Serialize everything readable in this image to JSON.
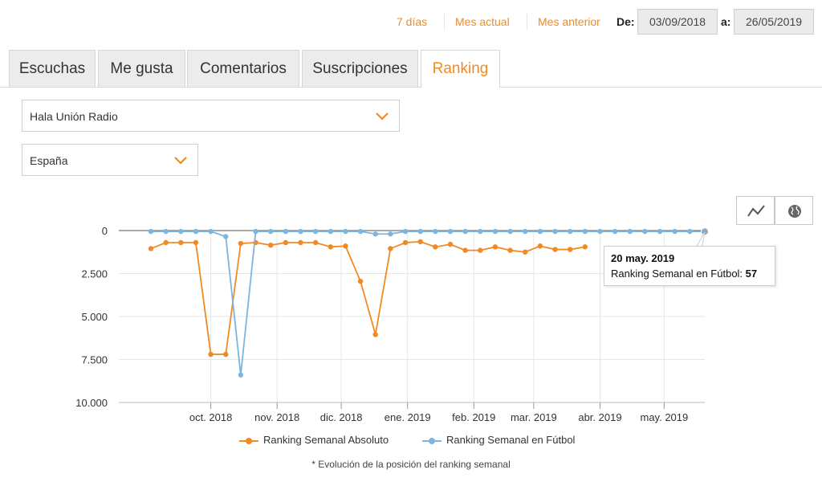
{
  "header": {
    "periods": [
      {
        "label": "7 días"
      },
      {
        "label": "Mes actual"
      },
      {
        "label": "Mes anterior"
      }
    ],
    "from_label": "De:",
    "from_date": "03/09/2018",
    "to_label": "a:",
    "to_date": "26/05/2019"
  },
  "tabs": [
    {
      "label": "Escuchas",
      "active": false
    },
    {
      "label": "Me gusta",
      "active": false
    },
    {
      "label": "Comentarios",
      "active": false
    },
    {
      "label": "Suscripciones",
      "active": false
    },
    {
      "label": "Ranking",
      "active": true
    }
  ],
  "filters": {
    "program": "Hala Unión Radio",
    "country": "España"
  },
  "chart_tools": {
    "line_icon": "line-chart-icon",
    "map_icon": "globe-icon"
  },
  "colors": {
    "accent": "#f08a24",
    "series_absoluto": "#f08a24",
    "series_futbol": "#7cb5de"
  },
  "chart_data": {
    "type": "line",
    "y_reversed": true,
    "ylim": [
      0,
      10000
    ],
    "y_ticks": [
      {
        "value": 0,
        "label": "0"
      },
      {
        "value": 2500,
        "label": "2.500"
      },
      {
        "value": 5000,
        "label": "5.000"
      },
      {
        "value": 7500,
        "label": "7.500"
      },
      {
        "value": 10000,
        "label": "10.000"
      }
    ],
    "x_range": [
      "2018-09-03",
      "2019-05-20"
    ],
    "x_ticks": [
      {
        "date": "2018-10-01",
        "label": "oct. 2018"
      },
      {
        "date": "2018-11-01",
        "label": "nov. 2018"
      },
      {
        "date": "2018-12-01",
        "label": "dic. 2018"
      },
      {
        "date": "2019-01-01",
        "label": "ene. 2019"
      },
      {
        "date": "2019-02-01",
        "label": "feb. 2019"
      },
      {
        "date": "2019-03-01",
        "label": "mar. 2019"
      },
      {
        "date": "2019-04-01",
        "label": "abr. 2019"
      },
      {
        "date": "2019-05-01",
        "label": "may. 2019"
      }
    ],
    "x_dates": [
      "2018-09-03",
      "2018-09-10",
      "2018-09-17",
      "2018-09-24",
      "2018-10-01",
      "2018-10-08",
      "2018-10-15",
      "2018-10-22",
      "2018-10-29",
      "2018-11-05",
      "2018-11-12",
      "2018-11-19",
      "2018-11-26",
      "2018-12-03",
      "2018-12-10",
      "2018-12-17",
      "2018-12-24",
      "2018-12-31",
      "2019-01-07",
      "2019-01-14",
      "2019-01-21",
      "2019-01-28",
      "2019-02-04",
      "2019-02-11",
      "2019-02-18",
      "2019-02-25",
      "2019-03-04",
      "2019-03-11",
      "2019-03-18",
      "2019-03-25",
      "2019-04-01",
      "2019-04-08",
      "2019-04-15",
      "2019-04-22",
      "2019-04-29",
      "2019-05-06",
      "2019-05-13",
      "2019-05-20"
    ],
    "series": [
      {
        "name": "Ranking Semanal Absoluto",
        "values": [
          1050,
          700,
          700,
          700,
          7200,
          7200,
          750,
          700,
          850,
          700,
          700,
          700,
          950,
          900,
          2950,
          6050,
          1050,
          700,
          650,
          950,
          800,
          1150,
          1150,
          950,
          1150,
          1250,
          900,
          1100,
          1100,
          950,
          null,
          null,
          null,
          null,
          null,
          null,
          null,
          null
        ]
      },
      {
        "name": "Ranking Semanal en Fútbol",
        "values": [
          50,
          50,
          50,
          50,
          50,
          350,
          8400,
          50,
          50,
          50,
          50,
          50,
          50,
          50,
          50,
          200,
          200,
          50,
          50,
          50,
          50,
          50,
          50,
          50,
          50,
          50,
          50,
          50,
          50,
          50,
          50,
          50,
          50,
          50,
          50,
          50,
          50,
          57
        ]
      }
    ],
    "tooltip": {
      "date": "20 may. 2019",
      "series": "Ranking Semanal en Fútbol:",
      "value": "57"
    },
    "footnote": "* Evolución de la posición del ranking semanal"
  }
}
